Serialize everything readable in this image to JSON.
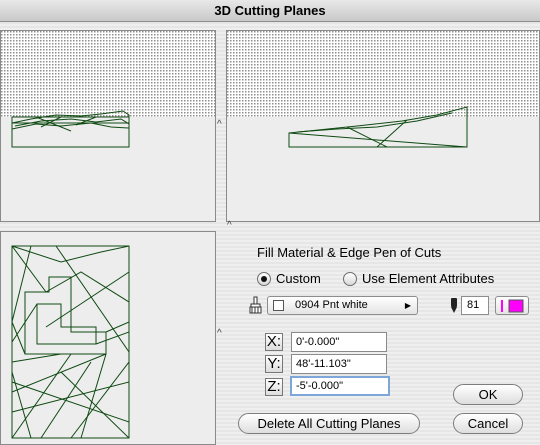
{
  "window": {
    "title": "3D Cutting Planes"
  },
  "fill_section": {
    "heading": "Fill Material & Edge Pen of Cuts",
    "option_custom": "Custom",
    "option_element": "Use Element Attributes",
    "material_value": "0904 Pnt white",
    "pen_number": "81",
    "pen_color": "#ff00ff"
  },
  "coordinates": {
    "x_label": "X:",
    "x_value": "0'-0.000\"",
    "y_label": "Y:",
    "y_value": "48'-11.103\"",
    "z_label": "Z:",
    "z_value": "-5'-0.000\""
  },
  "buttons": {
    "delete_all": "Delete All Cutting Planes",
    "ok": "OK",
    "cancel": "Cancel"
  },
  "colors": {
    "drawing_lines": "#0f4a12",
    "hatch": "#9a9a9a"
  }
}
